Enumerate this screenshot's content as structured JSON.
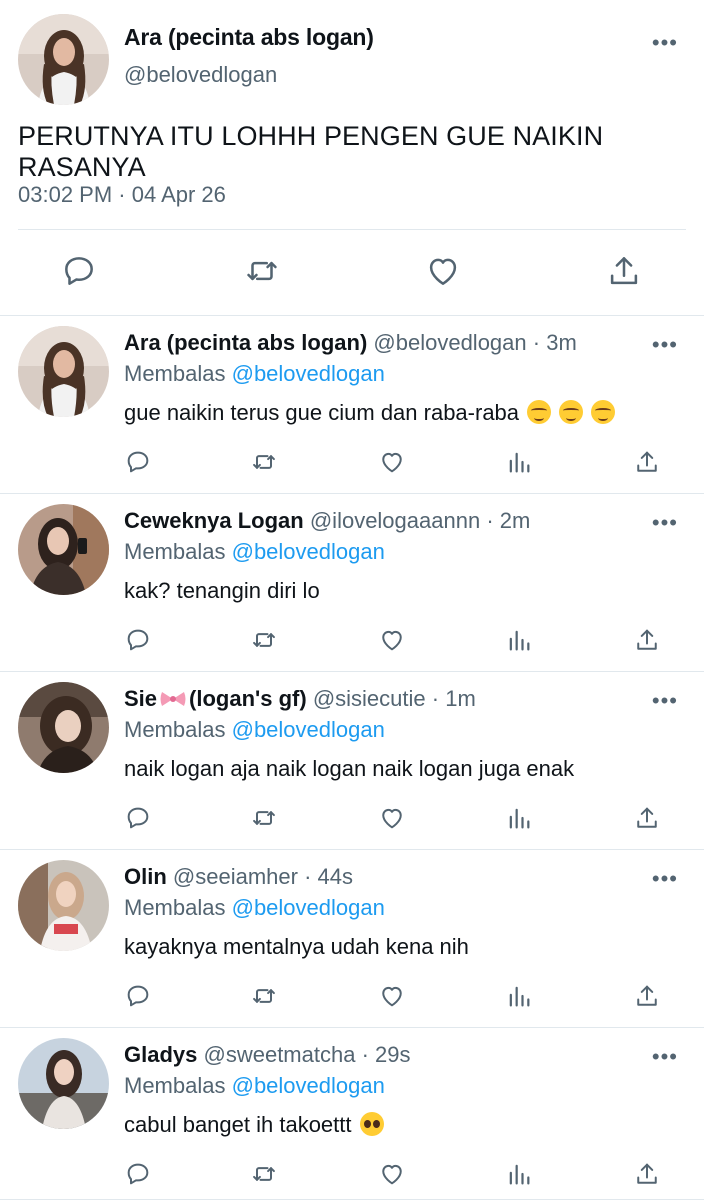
{
  "main_tweet": {
    "author_name": "Ara (pecinta abs logan)",
    "handle": "@belovedlogan",
    "text": "PERUTNYA ITU LOHHH PENGEN GUE NAIKIN RASANYA",
    "timestamp": "03:02 PM · 04 Apr 26",
    "actions": [
      "reply-icon",
      "retweet-icon",
      "like-icon",
      "share-icon"
    ]
  },
  "reply_prefix": "Membalas",
  "reply_to": "@belovedlogan",
  "replies": [
    {
      "name": "Ara (pecinta abs logan)",
      "handle": "@belovedlogan",
      "time": "3m",
      "text": "gue naikin terus gue cium dan raba-raba",
      "emojis": [
        "relieved",
        "relieved",
        "relieved"
      ],
      "avatar_colors": [
        "#d6c7bd",
        "#4a3326"
      ]
    },
    {
      "name": "Ceweknya Logan",
      "handle": "@ilovelogaaannn",
      "time": "2m",
      "text": "kak? tenangin diri lo",
      "avatar_colors": [
        "#b89b8a",
        "#2e221d"
      ]
    },
    {
      "name_part1": "Sie",
      "name_part2": "(logan's gf)",
      "handle": "@sisiecutie",
      "time": "1m",
      "text": "naik logan aja naik logan naik logan juga enak",
      "avatar_colors": [
        "#8f7b6e",
        "#3b2b22"
      ]
    },
    {
      "name": "Olin",
      "handle": "@seeiamher",
      "time": "44s",
      "text": "kayaknya mentalnya udah kena nih",
      "avatar_colors": [
        "#caa88c",
        "#c9c3bb"
      ]
    },
    {
      "name": "Gladys",
      "handle": "@sweetmatcha",
      "time": "29s",
      "text": "cabul banget ih takoettt",
      "emojis": [
        "pleading"
      ],
      "avatar_colors": [
        "#c7d3df",
        "#3a2b25"
      ]
    }
  ],
  "colors": {
    "text_primary": "#0f1419",
    "text_secondary": "#536471",
    "accent": "#1d9bf0",
    "divider": "#e1e8ed"
  }
}
